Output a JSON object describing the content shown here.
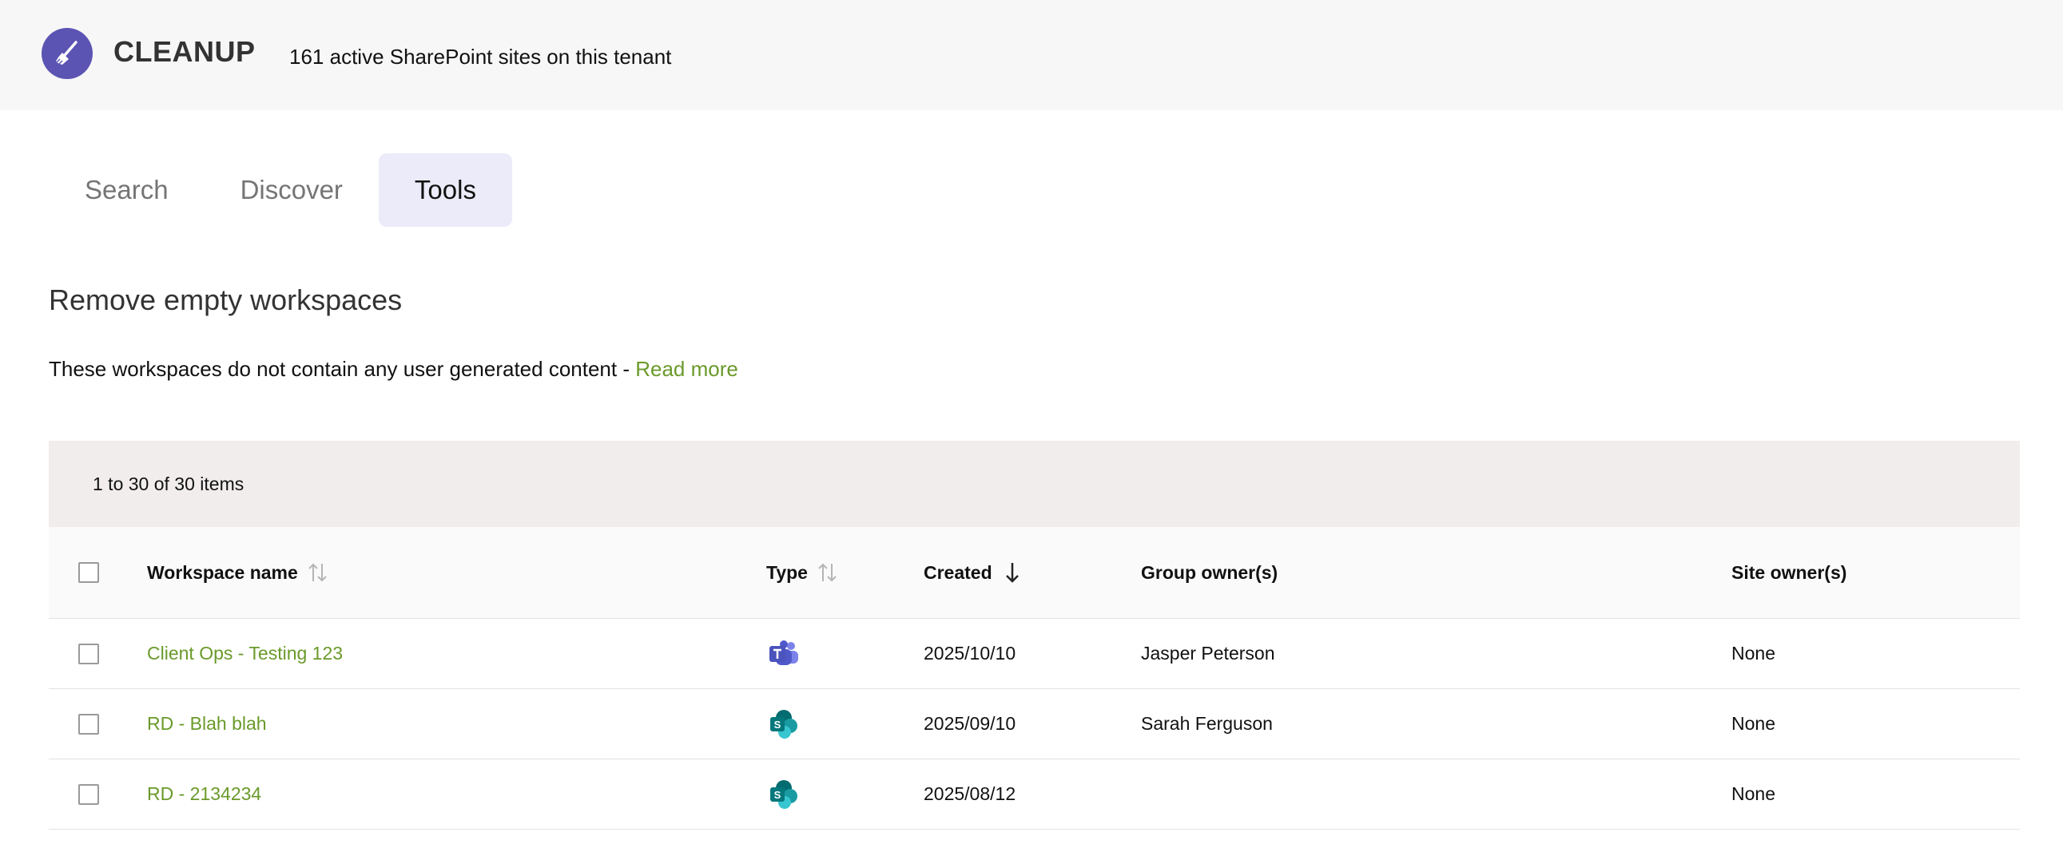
{
  "app": {
    "title": "CLEANUP",
    "subtitle": "161 active SharePoint sites on this tenant",
    "logo_icon": "broom-icon",
    "brand_color": "#5b54b3"
  },
  "tabs": [
    {
      "label": "Search",
      "active": false
    },
    {
      "label": "Discover",
      "active": false
    },
    {
      "label": "Tools",
      "active": true
    }
  ],
  "section": {
    "title": "Remove empty workspaces",
    "description": "These workspaces do not contain any user generated content - ",
    "read_more": "Read more",
    "link_color": "#6a9a2a"
  },
  "grid": {
    "info": "1 to 30 of 30 items",
    "columns": {
      "name": "Workspace name",
      "type": "Type",
      "created": "Created",
      "group_owners": "Group owner(s)",
      "site_owners": "Site owner(s)"
    },
    "sort": {
      "column": "created",
      "direction": "descending"
    },
    "rows": [
      {
        "name": "Client Ops - Testing 123",
        "type": "teams-icon",
        "created": "2025/10/10",
        "group_owners": "Jasper Peterson",
        "site_owners": "None"
      },
      {
        "name": "RD - Blah blah",
        "type": "sharepoint-icon",
        "created": "2025/09/10",
        "group_owners": "Sarah Ferguson",
        "site_owners": "None"
      },
      {
        "name": "RD - 2134234",
        "type": "sharepoint-icon",
        "created": "2025/08/12",
        "group_owners": "",
        "site_owners": "None"
      }
    ]
  }
}
